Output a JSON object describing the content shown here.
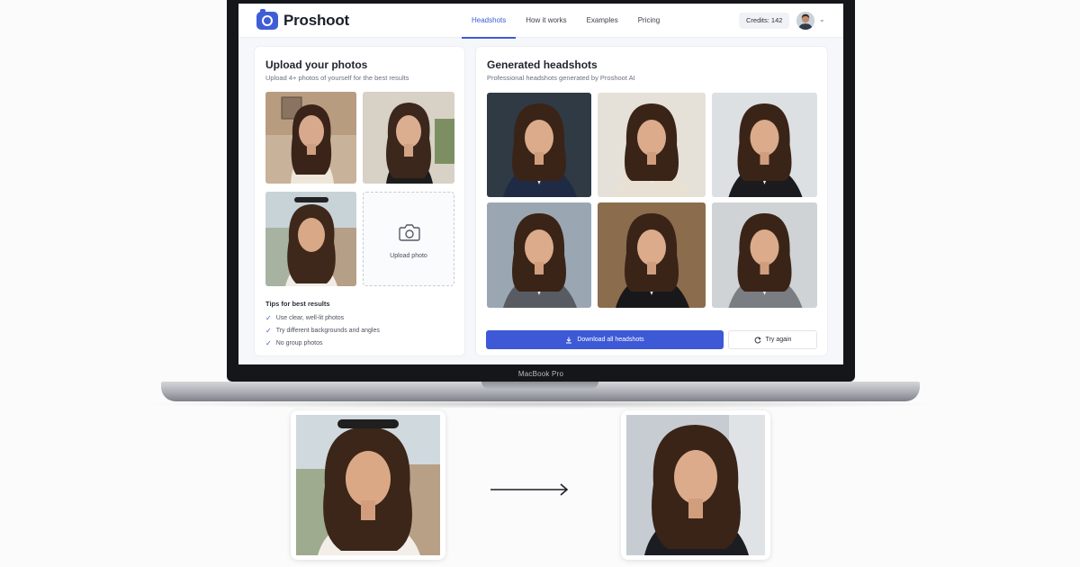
{
  "brand": {
    "name": "Proshoot",
    "icon": "camera-icon",
    "accent": "#3d5bd4"
  },
  "nav": {
    "items": [
      {
        "label": "Headshots",
        "active": true
      },
      {
        "label": "How it works",
        "active": false
      },
      {
        "label": "Examples",
        "active": false
      },
      {
        "label": "Pricing",
        "active": false
      }
    ]
  },
  "header": {
    "credits": "Credits: 142",
    "avatar_icon": "user-avatar",
    "menu_icon": "chevron-down-icon"
  },
  "upload": {
    "title": "Upload your photos",
    "subtitle": "Upload 4+ photos of yourself for the best results",
    "upload_label": "Upload photo",
    "tips_title": "Tips for best results",
    "tips": [
      "Use clear, well-lit photos",
      "Try different backgrounds and angles",
      "No group photos"
    ]
  },
  "generated": {
    "title": "Generated headshots",
    "subtitle": "Professional headshots generated by Proshoot AI",
    "download_label": "Download all headshots",
    "retry_label": "Try again"
  },
  "device": {
    "label": "MacBook Pro"
  }
}
